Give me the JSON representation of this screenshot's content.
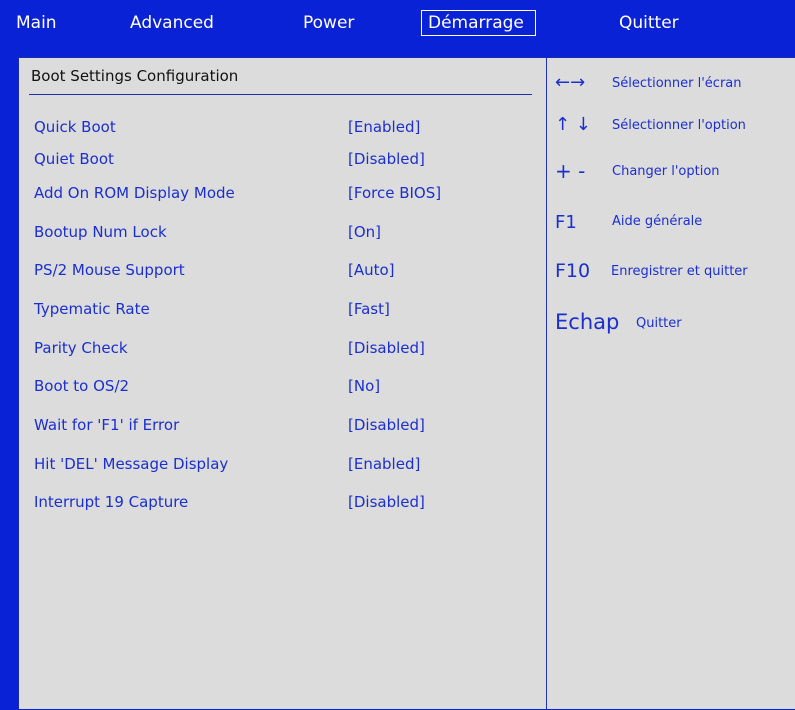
{
  "menu": {
    "items": [
      {
        "label": "Main"
      },
      {
        "label": "Advanced"
      },
      {
        "label": "Power"
      },
      {
        "label": "Démarrage"
      },
      {
        "label": "Quitter"
      }
    ]
  },
  "main": {
    "title": "Boot Settings Configuration",
    "options": [
      {
        "label": "Quick Boot",
        "value": "[Enabled]"
      },
      {
        "label": "Quiet Boot",
        "value": "[Disabled]"
      },
      {
        "label": "Add On ROM Display Mode",
        "value": "[Force BIOS]"
      },
      {
        "label": "Bootup Num Lock",
        "value": "[On]"
      },
      {
        "label": "PS/2 Mouse Support",
        "value": "[Auto]"
      },
      {
        "label": "Typematic Rate",
        "value": "[Fast]"
      },
      {
        "label": "Parity Check",
        "value": "[Disabled]"
      },
      {
        "label": "Boot to OS/2",
        "value": "[No]"
      },
      {
        "label": "Wait for 'F1' if Error",
        "value": "[Disabled]"
      },
      {
        "label": "Hit 'DEL' Message Display",
        "value": "[Enabled]"
      },
      {
        "label": "Interrupt 19 Capture",
        "value": "[Disabled]"
      }
    ]
  },
  "help": {
    "items": [
      {
        "key": "←→",
        "desc": "Sélectionner l'écran"
      },
      {
        "key": "↑ ↓",
        "desc": "Sélectionner l'option"
      },
      {
        "key": "+ -",
        "desc": "Changer l'option"
      },
      {
        "key": "F1",
        "desc": "Aide générale"
      },
      {
        "key": "F10",
        "desc": "Enregistrer et quitter"
      },
      {
        "key": "Echap",
        "desc": "Quitter"
      }
    ]
  },
  "colors": {
    "menubar": "#0a22d6",
    "panel": "#dcdcdc",
    "text_blue": "#1b2fd0"
  }
}
